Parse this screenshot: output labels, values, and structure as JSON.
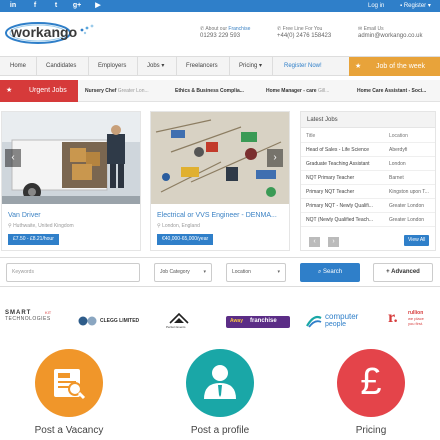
{
  "topbar": {
    "social": [
      {
        "icon": "linkedin-icon",
        "glyph": "in"
      },
      {
        "icon": "facebook-icon",
        "glyph": "f"
      },
      {
        "icon": "twitter-icon",
        "glyph": "t"
      },
      {
        "icon": "google-plus-icon",
        "glyph": "g+"
      },
      {
        "icon": "youtube-icon",
        "glyph": "▶"
      }
    ],
    "login_label": "Log in",
    "register_label": "Register"
  },
  "header": {
    "logo_text": "workango",
    "about_label": "About our",
    "about_link": "Franchise",
    "about_phone": "01293 229 593",
    "freeline_label": "Free Line For You",
    "freeline_phone": "+44(0) 2476 158423",
    "email_label": "Email Us",
    "email_value": "admin@workango.co.uk"
  },
  "nav": {
    "items": [
      "Home",
      "Candidates",
      "Employers",
      "Jobs",
      "Freelancers",
      "Pricing"
    ],
    "register": "Register Now!",
    "job_week": "Job of the week"
  },
  "urgent": {
    "label": "Urgent Jobs",
    "items": [
      {
        "title": "Nursery Chef",
        "loc": "Greater Lon..."
      },
      {
        "title": "Ethics & Business Complia...",
        "loc": ""
      },
      {
        "title": "Home Manager - care",
        "loc": "Gill..."
      },
      {
        "title": "Home Care Assistant - Soci...",
        "loc": ""
      }
    ]
  },
  "featured": [
    {
      "title": "Van Driver",
      "location": "Huthwaite, United Kingdom",
      "salary": "£7.50 - £8.21/hour"
    },
    {
      "title": "Electrical or VVS Engineer - DENMA...",
      "location": "London, England",
      "salary": "€40,000-65,000/year"
    }
  ],
  "latest": {
    "heading": "Latest Jobs",
    "col_title": "Title",
    "col_location": "Location",
    "rows": [
      {
        "title": "Head of Sales - Life Science",
        "location": "Aberdyfi"
      },
      {
        "title": "Graduate Teaching Assistant",
        "location": "London"
      },
      {
        "title": "NQT Primary Teacher",
        "location": "Barnet"
      },
      {
        "title": "Primary NQT Teacher",
        "location": "Kingston upon T..."
      },
      {
        "title": "Primary NQT - Newly Qualifi...",
        "location": "Greater London"
      },
      {
        "title": "NQT (Newly Qualified Teach...",
        "location": "Greater London"
      }
    ],
    "view_all": "View All"
  },
  "search": {
    "keywords_placeholder": "Keywords",
    "category": "Job Category",
    "location": "Location",
    "search_label": "Search",
    "advanced_label": "Advanced"
  },
  "partners": [
    {
      "line1": "SMART",
      "line2": "TECHNOLOGIES",
      "tag": "KIT"
    },
    {
      "name": "CLEGG LIMITED"
    },
    {
      "name": "Perfect Events"
    },
    {
      "name": "franchise",
      "prefix": "Away"
    },
    {
      "line1": "computer",
      "line2": "people"
    },
    {
      "name": "r.",
      "line1": "rullion",
      "line2": "we place",
      "line3": "you first."
    }
  ],
  "features": [
    {
      "title": "Post a Vacancy",
      "color": "#f0962a",
      "icon": "job-search-icon"
    },
    {
      "title": "Post a profile",
      "color": "#1aa7a7",
      "icon": "profile-icon"
    },
    {
      "title": "Pricing",
      "color": "#e4444a",
      "icon": "pound-icon"
    }
  ],
  "colors": {
    "primary": "#2f7fc9",
    "accent": "#e8a33a",
    "urgent": "#d63a3a"
  }
}
